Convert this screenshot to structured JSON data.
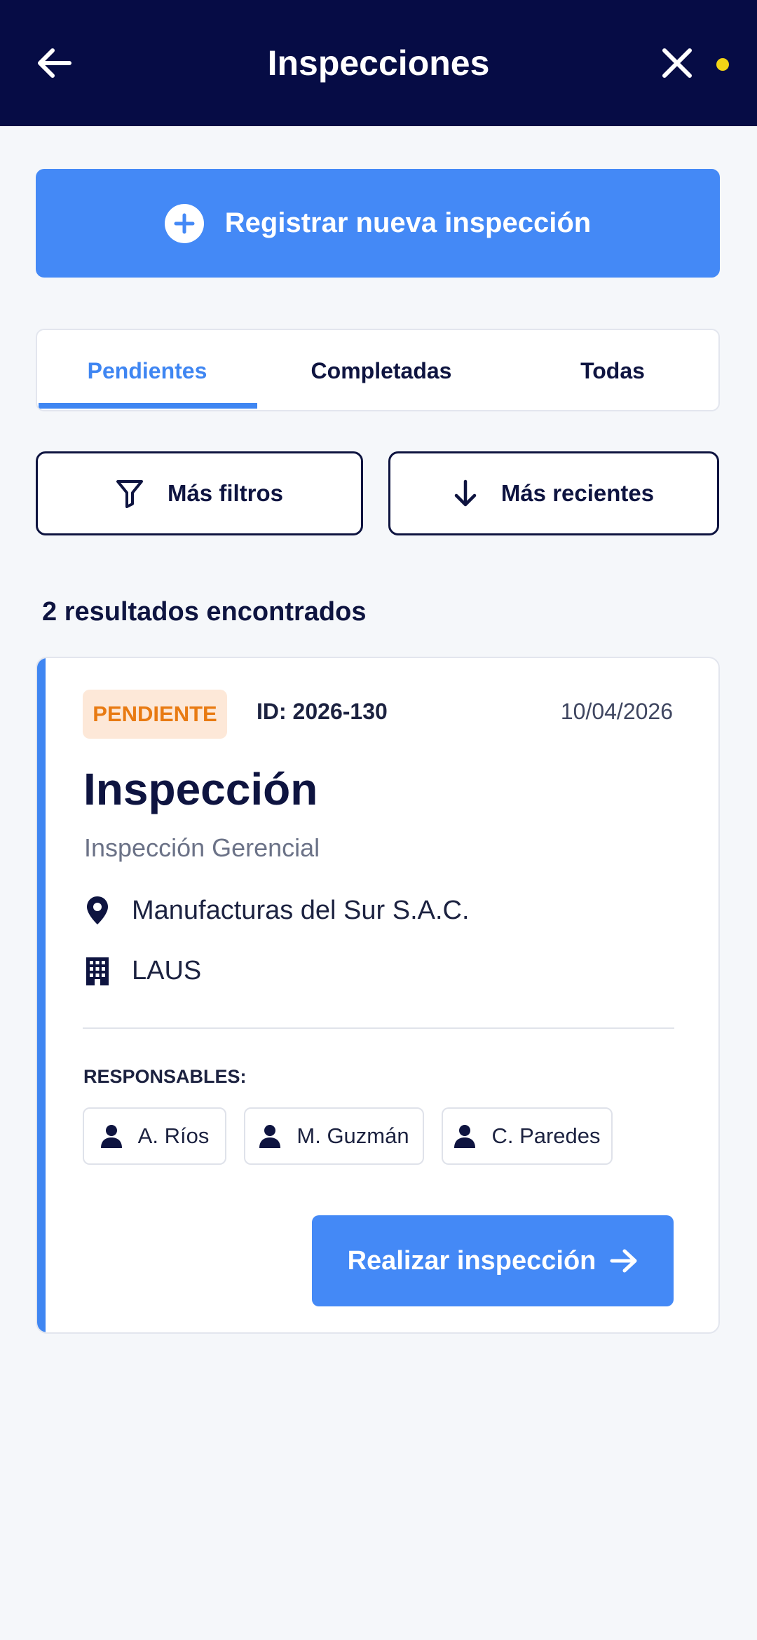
{
  "header": {
    "title": "Inspecciones",
    "back_icon": "arrow-left-icon",
    "close_icon": "close-icon",
    "dot_color": "#f2d416"
  },
  "new_inspection": {
    "label": "Registrar nueva inspección",
    "icon": "plus-circle-icon"
  },
  "tabs": [
    {
      "label": "Pendientes",
      "active": true
    },
    {
      "label": "Completadas",
      "active": false
    },
    {
      "label": "Todas",
      "active": false
    }
  ],
  "filters": {
    "more_filters_label": "Más filtros",
    "sort_label": "Más recientes"
  },
  "results_text": "2 resultados encontrados",
  "card": {
    "status": "PENDIENTE",
    "id": "ID: 2026-130",
    "date": "10/04/2026",
    "title": "Inspección",
    "subtitle": "Inspección Gerencial",
    "company": "Manufacturas del Sur S.A.C.",
    "site": "LAUS",
    "responsables_label": "RESPONSABLES:",
    "responsables": [
      "A. Ríos",
      "M. Guzmán",
      "C. Paredes"
    ],
    "action_label": "Realizar inspección"
  },
  "colors": {
    "header_bg": "#060c45",
    "accent": "#4489f6",
    "status_text": "#e87a12",
    "status_bg": "#fde8d8"
  }
}
